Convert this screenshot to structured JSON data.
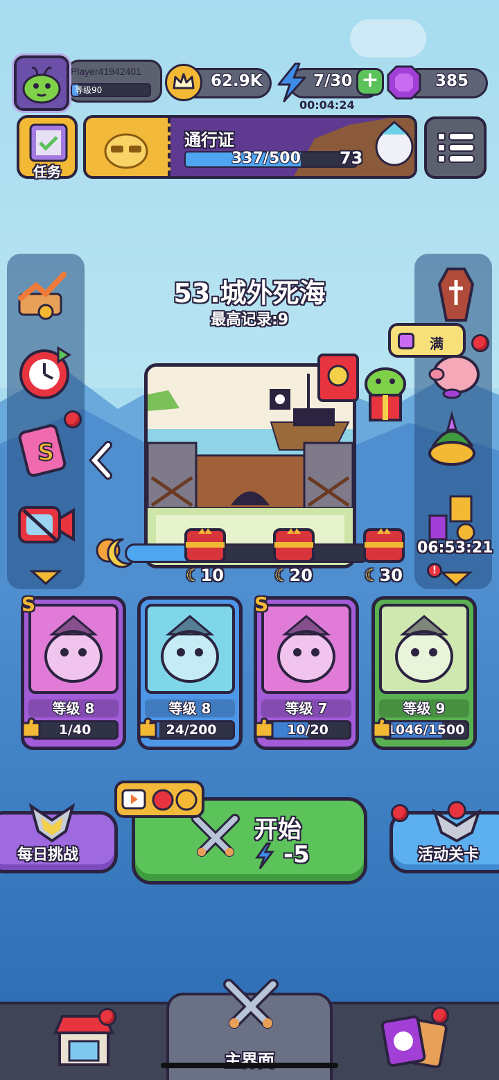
{
  "player": {
    "name": "Player41942401",
    "level_label": "等级90",
    "level_progress": 0.08
  },
  "resources": {
    "coins": "62.9K",
    "energy": "7/30",
    "energy_timer": "00:04:24",
    "gems": "385"
  },
  "task_label": "任务",
  "pass": {
    "title": "通行证",
    "progress_text": "337/500",
    "progress_value": 337,
    "progress_max": 500,
    "level": "73"
  },
  "level": {
    "title": "53.城外死海",
    "record": "最高记录:9"
  },
  "piggy_label": "满",
  "event_timer": "06:53:21",
  "chests": [
    {
      "label": "10",
      "color": "#d8343c"
    },
    {
      "label": "20",
      "color": "#d8343c"
    },
    {
      "label": "30",
      "color": "#d8343c"
    }
  ],
  "wave_progress": 0.26,
  "cards": [
    {
      "level": "等级 8",
      "progress": "1/40",
      "rank": "S",
      "color": "#a25cd8",
      "inner": "#e07cd8",
      "fill": 0.025
    },
    {
      "level": "等级 8",
      "progress": "24/200",
      "rank": "",
      "color": "#4e96e8",
      "inner": "#7fd6e8",
      "fill": 0.12
    },
    {
      "level": "等级 7",
      "progress": "10/20",
      "rank": "S",
      "color": "#a25cd8",
      "inner": "#e07cd8",
      "fill": 0.5
    },
    {
      "level": "等级 9",
      "progress": "1046/1500",
      "rank": "",
      "color": "#58b050",
      "inner": "#cfe8b0",
      "fill": 0.697
    }
  ],
  "buttons": {
    "daily": "每日挑战",
    "start": "开始",
    "start_cost": "-5",
    "event": "活动关卡"
  },
  "nav": {
    "main": "主界面"
  },
  "colors": {
    "accent_blue": "#4ea6f0",
    "panel_dark": "#2b2340",
    "green": "#5cc25a",
    "purple": "#a25cd8"
  }
}
